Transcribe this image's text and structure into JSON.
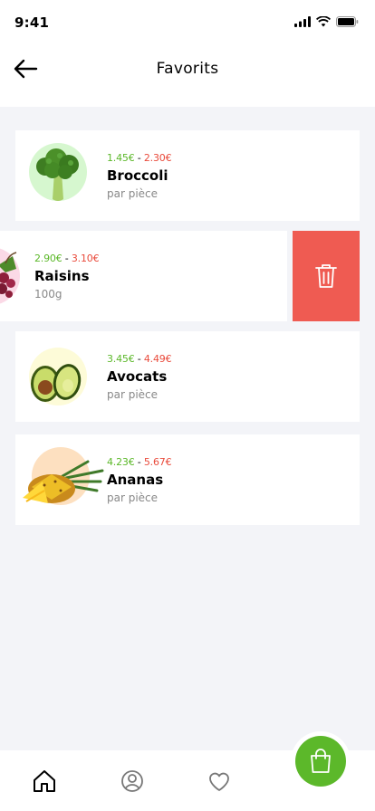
{
  "status_bar": {
    "time": "9:41"
  },
  "header": {
    "title": "Favorits"
  },
  "items": [
    {
      "price_low": "1.45€",
      "separator": "-",
      "price_high": "2.30€",
      "name": "Broccoli",
      "unit": "par pièce"
    },
    {
      "price_low": "2.90€",
      "separator": "-",
      "price_high": "3.10€",
      "name": "Raisins",
      "unit": "100g"
    },
    {
      "price_low": "3.45€",
      "separator": "-",
      "price_high": "4.49€",
      "name": "Avocats",
      "unit": "par pièce"
    },
    {
      "price_low": "4.23€",
      "separator": "-",
      "price_high": "5.67€",
      "name": "Ananas",
      "unit": "par pièce"
    }
  ],
  "colors": {
    "accent_green": "#5cb82a",
    "price_high_red": "#e94b3c",
    "delete_red": "#ef5b52"
  },
  "icons": {
    "back": "arrow-left-icon",
    "delete": "trash-icon",
    "home": "home-icon",
    "profile": "user-icon",
    "favorites": "heart-icon",
    "cart": "shopping-bag-icon"
  }
}
